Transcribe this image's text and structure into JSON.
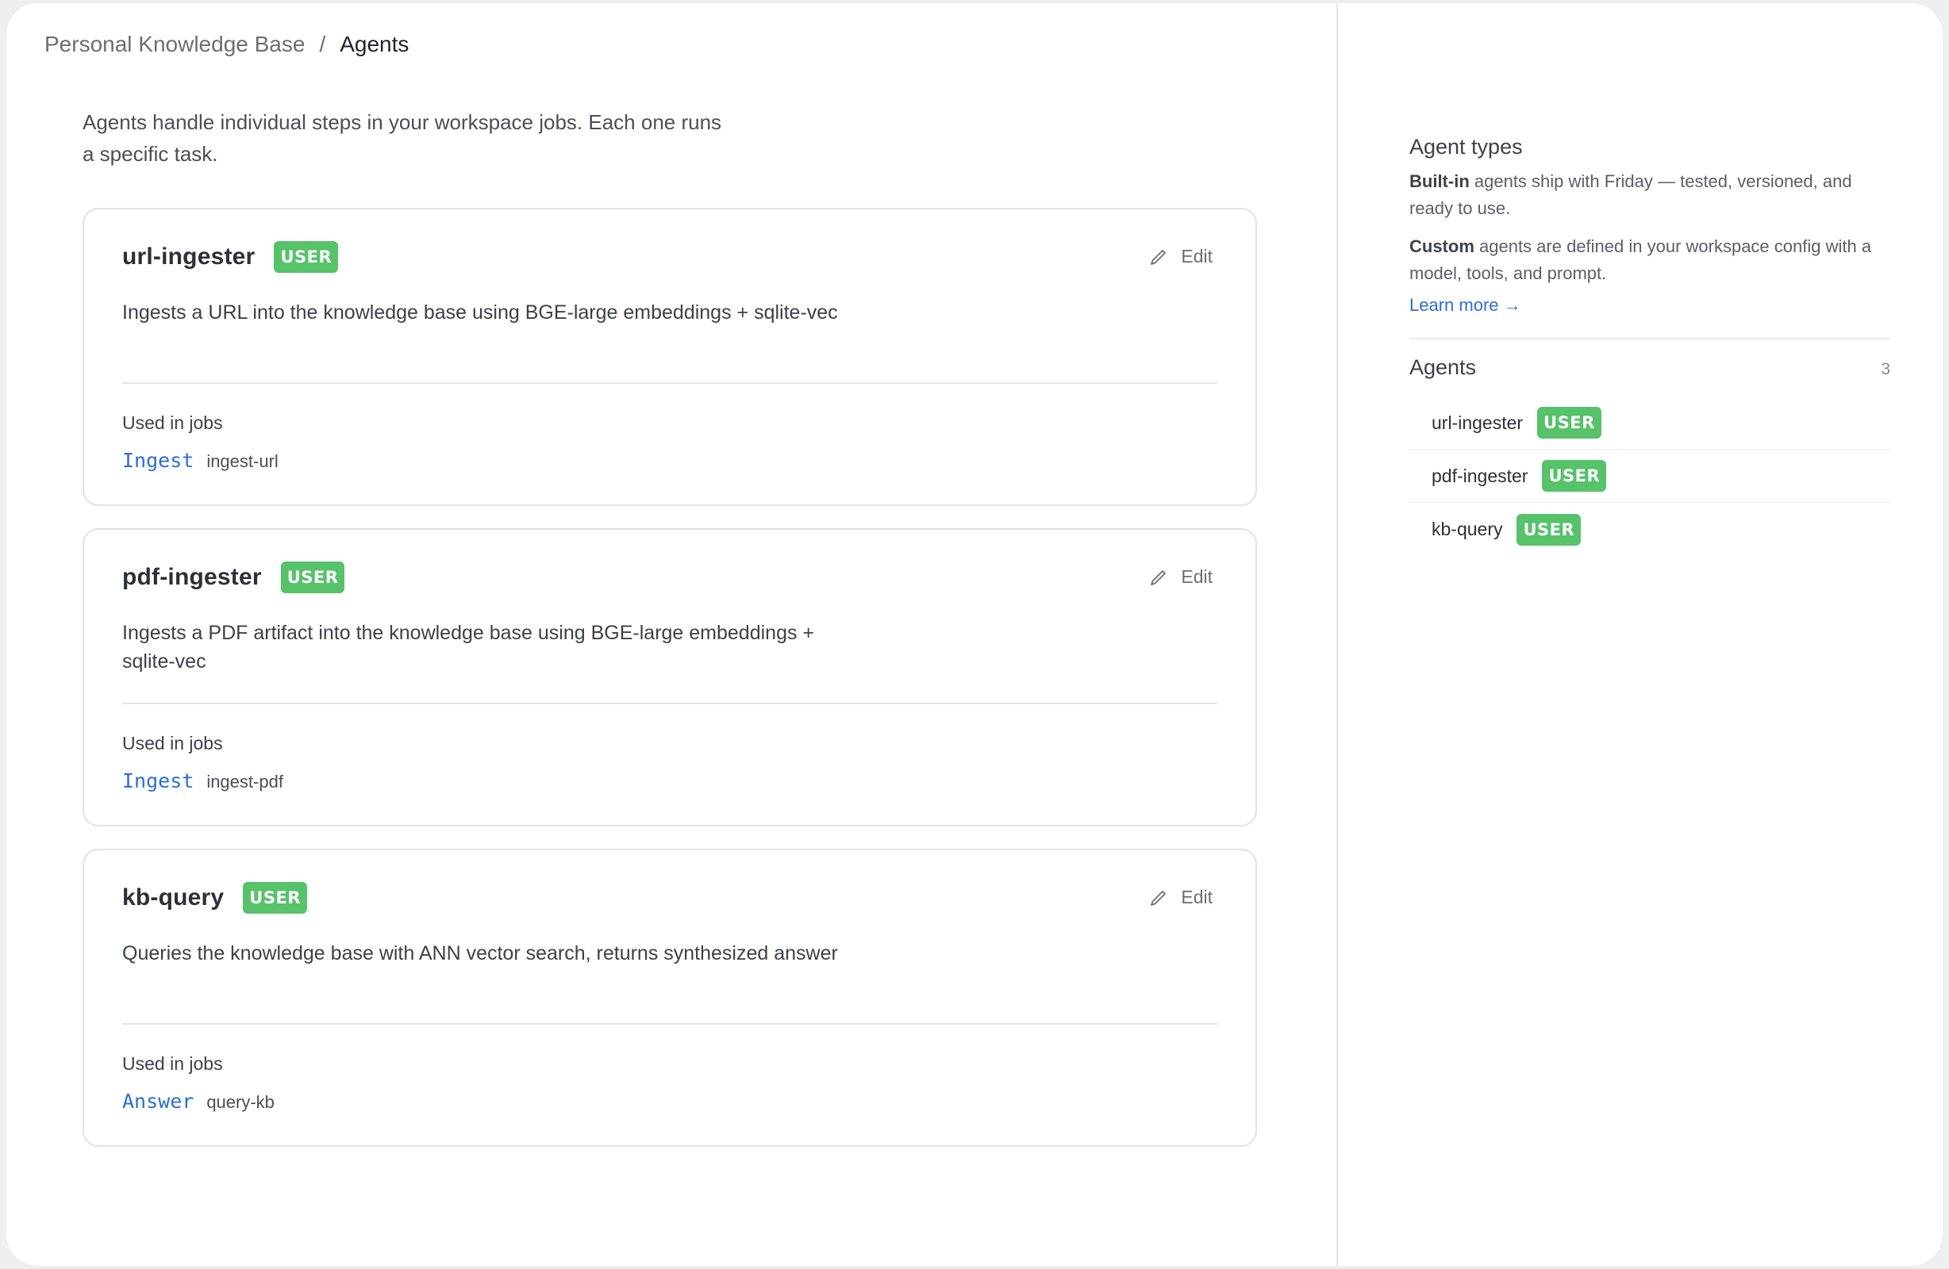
{
  "breadcrumb": {
    "parent": "Personal Knowledge Base",
    "separator": "/",
    "current": "Agents"
  },
  "intro": "Agents handle individual steps in your workspace jobs. Each one runs a specific task.",
  "cards": [
    {
      "name": "url-ingester",
      "badge": "USER",
      "edit_label": "Edit",
      "description": "Ingests a URL into the knowledge base using BGE-large embeddings + sqlite-vec",
      "used_in_label": "Used in jobs",
      "job_link": "Ingest",
      "job_id": "ingest-url"
    },
    {
      "name": "pdf-ingester",
      "badge": "USER",
      "edit_label": "Edit",
      "description": "Ingests a PDF artifact into the knowledge base using BGE-large embeddings + sqlite-vec",
      "used_in_label": "Used in jobs",
      "job_link": "Ingest",
      "job_id": "ingest-pdf"
    },
    {
      "name": "kb-query",
      "badge": "USER",
      "edit_label": "Edit",
      "description": "Queries the knowledge base with ANN vector search, returns synthesized answer",
      "used_in_label": "Used in jobs",
      "job_link": "Answer",
      "job_id": "query-kb"
    }
  ],
  "aside": {
    "types_title": "Agent types",
    "builtin_bold": "Built-in",
    "builtin_text": " agents ship with Friday — tested, versioned, and ready to use.",
    "custom_bold": "Custom",
    "custom_text": " agents are defined in your workspace config with a model, tools, and prompt.",
    "learn_more": "Learn more →",
    "agents_title": "Agents",
    "agents_count": "3",
    "agents": [
      {
        "name": "url-ingester",
        "badge": "USER"
      },
      {
        "name": "pdf-ingester",
        "badge": "USER"
      },
      {
        "name": "kb-query",
        "badge": "USER"
      }
    ]
  },
  "colors": {
    "badge": "#56c26a",
    "link": "#2a6fd6",
    "border": "#e2e2e2"
  },
  "icons": {
    "edit": "pencil-icon"
  }
}
